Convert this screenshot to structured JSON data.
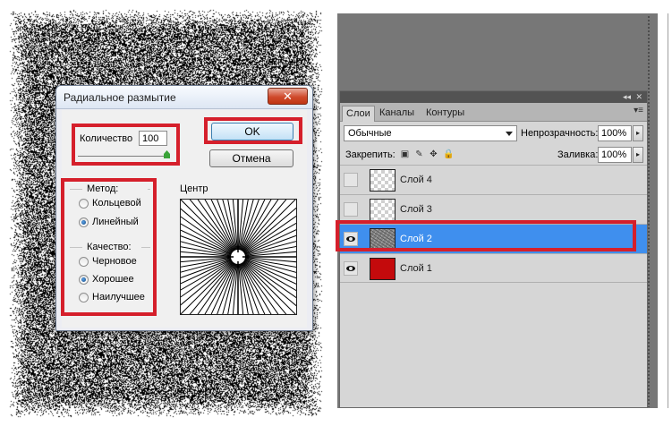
{
  "dialog": {
    "title": "Радиальное размытие",
    "close_glyph": "✕",
    "amount_label": "Количество",
    "amount_value": "100",
    "ok_label": "OK",
    "cancel_label": "Отмена",
    "method_label": "Метод:",
    "method_options": [
      {
        "label": "Кольцевой",
        "checked": false
      },
      {
        "label": "Линейный",
        "checked": true
      }
    ],
    "quality_label": "Качество:",
    "quality_options": [
      {
        "label": "Черновое",
        "checked": false
      },
      {
        "label": "Хорошее",
        "checked": true
      },
      {
        "label": "Наилучшее",
        "checked": false
      }
    ],
    "center_label": "Центр"
  },
  "panel": {
    "strip_buttons": [
      "◂◂",
      "✕"
    ],
    "tabs": [
      {
        "label": "Слои",
        "active": true
      },
      {
        "label": "Каналы",
        "active": false
      },
      {
        "label": "Контуры",
        "active": false
      }
    ],
    "menu_glyph": "▾≡",
    "blend_mode": "Обычные",
    "opacity_label": "Непрозрачность:",
    "opacity_value": "100%",
    "lock_label": "Закрепить:",
    "lock_icons": [
      "▣",
      "✎",
      "✥",
      "🔒"
    ],
    "fill_label": "Заливка:",
    "fill_value": "100%",
    "stepper_glyph": "▸",
    "layers": [
      {
        "name": "Слой 4",
        "visible": false,
        "selected": false,
        "thumb": "checker"
      },
      {
        "name": "Слой 3",
        "visible": false,
        "selected": false,
        "thumb": "checker"
      },
      {
        "name": "Слой 2",
        "visible": true,
        "selected": true,
        "thumb": "noise"
      },
      {
        "name": "Слой 1",
        "visible": true,
        "selected": false,
        "thumb": "red"
      }
    ]
  },
  "colors": {
    "highlight_red": "#d51f2b",
    "selection_blue": "#3f8fee",
    "layer1_red": "#c40a0c"
  }
}
